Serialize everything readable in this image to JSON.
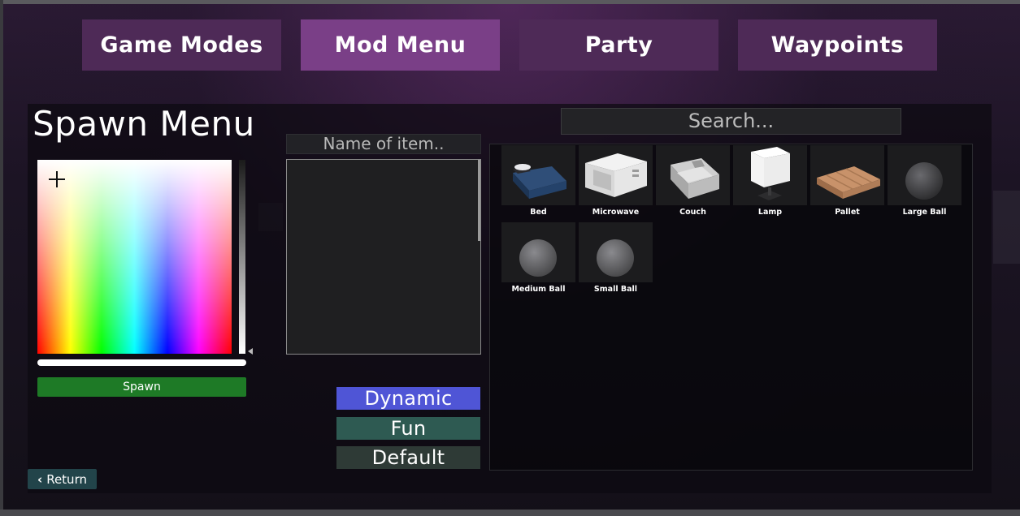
{
  "tabs": [
    {
      "label": "Game Modes",
      "active": false
    },
    {
      "label": "Mod Menu",
      "active": true
    },
    {
      "label": "Party",
      "active": false
    },
    {
      "label": "Waypoints",
      "active": false
    }
  ],
  "spawn_menu": {
    "title": "Spawn Menu",
    "spawn_label": "Spawn",
    "name_placeholder": "Name of item..",
    "search_placeholder": "Search..."
  },
  "modes": {
    "dynamic": "Dynamic",
    "fun": "Fun",
    "default": "Default"
  },
  "items": [
    {
      "label": "Bed",
      "icon": "bed-icon"
    },
    {
      "label": "Microwave",
      "icon": "microwave-icon"
    },
    {
      "label": "Couch",
      "icon": "couch-icon"
    },
    {
      "label": "Lamp",
      "icon": "lamp-icon"
    },
    {
      "label": "Pallet",
      "icon": "pallet-icon"
    },
    {
      "label": "Large Ball",
      "icon": "ball-icon"
    },
    {
      "label": "Medium Ball",
      "icon": "ball-icon"
    },
    {
      "label": "Small Ball",
      "icon": "ball-icon"
    }
  ],
  "return_label": "Return",
  "colors": {
    "active_tab": "#7a3f87",
    "tab": "#4e2a57",
    "spawn": "#1e7a26",
    "dynamic": "#4f55d6",
    "fun": "#2e5a52",
    "default": "#2e3a36"
  }
}
